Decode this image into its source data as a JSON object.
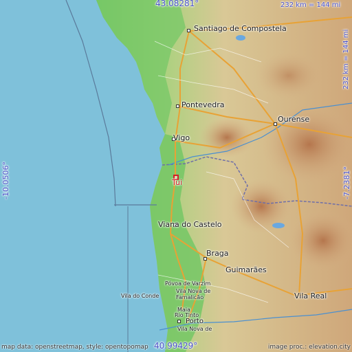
{
  "map": {
    "coords": {
      "top_lat": "43.08281°",
      "bottom_lat": "40.99429°",
      "left_lon": "-10.0506°",
      "right_lon": "-7.2381°"
    },
    "scale": {
      "top": "232 km = 144 mi",
      "right": "232 km = 144 mi"
    },
    "attribution_left": "map data: openstreetmap, style: opentopomap",
    "attribution_right": "image proc.: elevation.city",
    "highlight": "Tui",
    "places": {
      "santiago": "Santiago de Compostela",
      "pontevedra": "Pontevedra",
      "ourense": "Ourense",
      "vigo": "Vigo",
      "tui": "Tui",
      "viana": "Viana do Castelo",
      "braga": "Braga",
      "guimaraes": "Guimarães",
      "povoa": "Póvoa de Varzim",
      "vila_do_conde": "Vila do Conde",
      "famalicao": "Vila Nova de Famalicão",
      "maia": "Maia",
      "rio_tinto": "Rio Tinto",
      "porto": "Porto",
      "vila_nova": "Vila Nova de",
      "vila_real": "Vila Real"
    },
    "colors": {
      "sea": "#7fc1da",
      "lowland": "#7cc96a",
      "highland": "#d8b88a",
      "marker": "#d0202a"
    }
  }
}
